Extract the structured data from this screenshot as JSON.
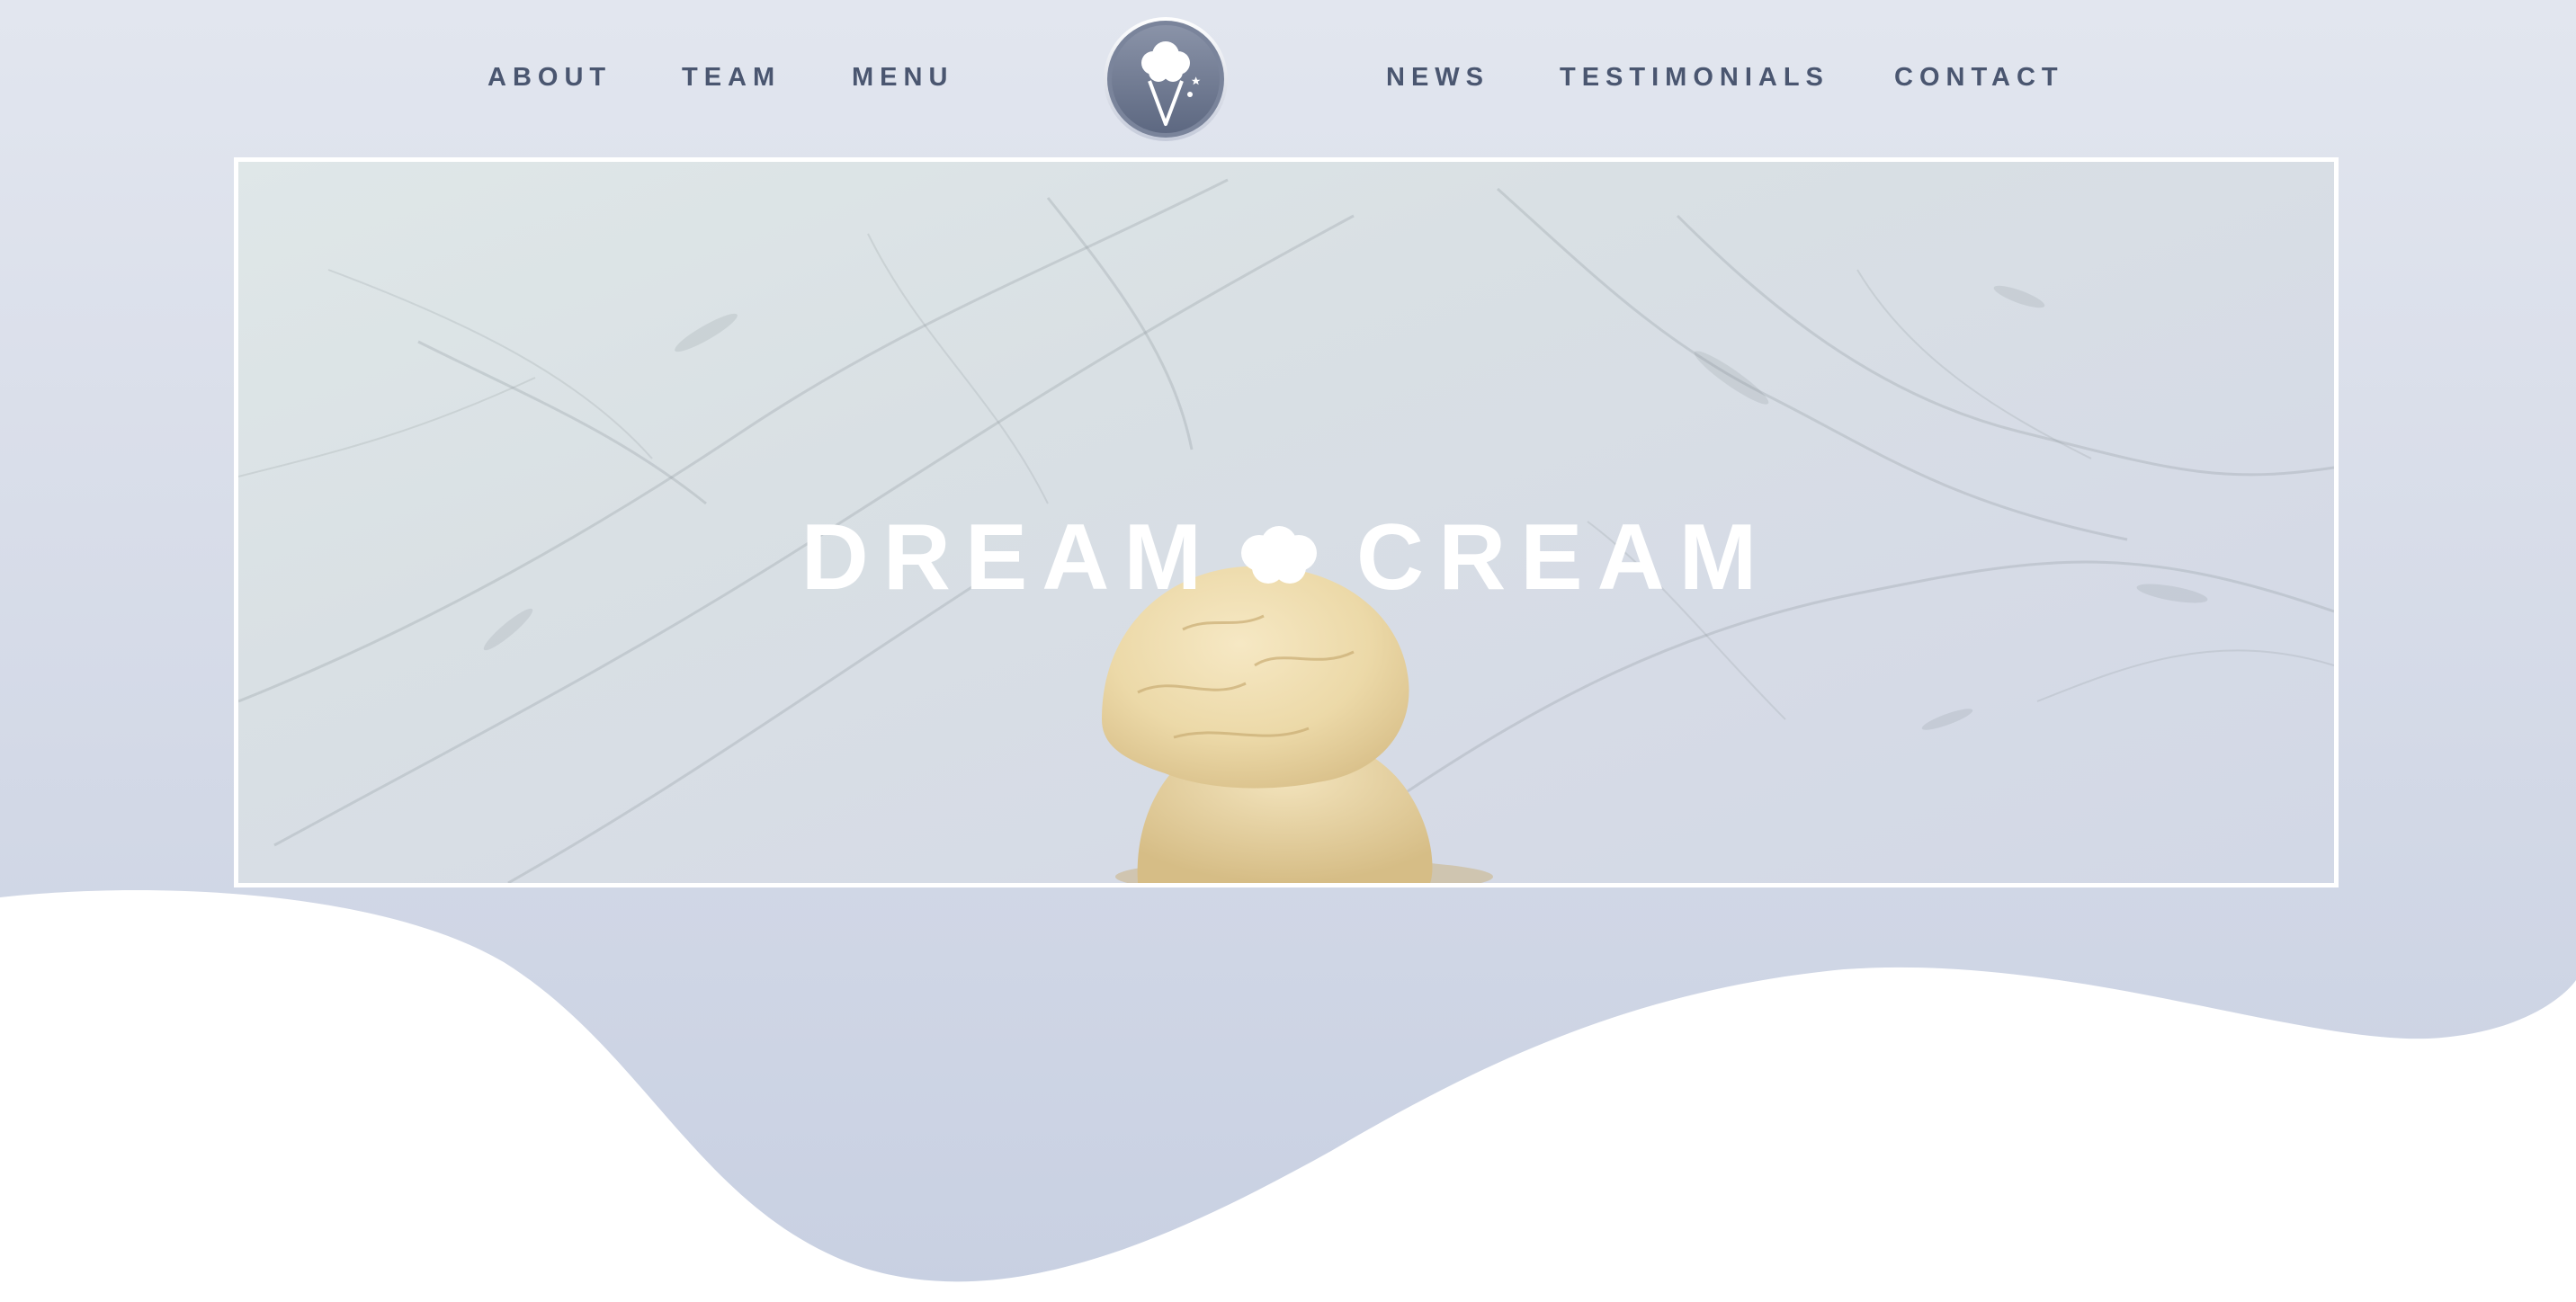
{
  "nav": {
    "left_items": [
      {
        "label": "ABOUT"
      },
      {
        "label": "TEAM"
      },
      {
        "label": "MENU"
      }
    ],
    "right_items": [
      {
        "label": "NEWS"
      },
      {
        "label": "TESTIMONIALS"
      },
      {
        "label": "CONTACT"
      }
    ],
    "logo_icon": "ice-cream-cone-icon"
  },
  "hero": {
    "title_left": "DREAM",
    "title_right": "CREAM",
    "separator_icon": "cloud-icon",
    "image": "ice-cream-scoops-on-marble"
  },
  "colors": {
    "nav_text": "#4a5670",
    "background_top": "#e2e6ef",
    "background_bottom": "#c8d0e2",
    "hero_border": "#ffffff",
    "hero_title": "#ffffff",
    "wave": "#ffffff"
  }
}
